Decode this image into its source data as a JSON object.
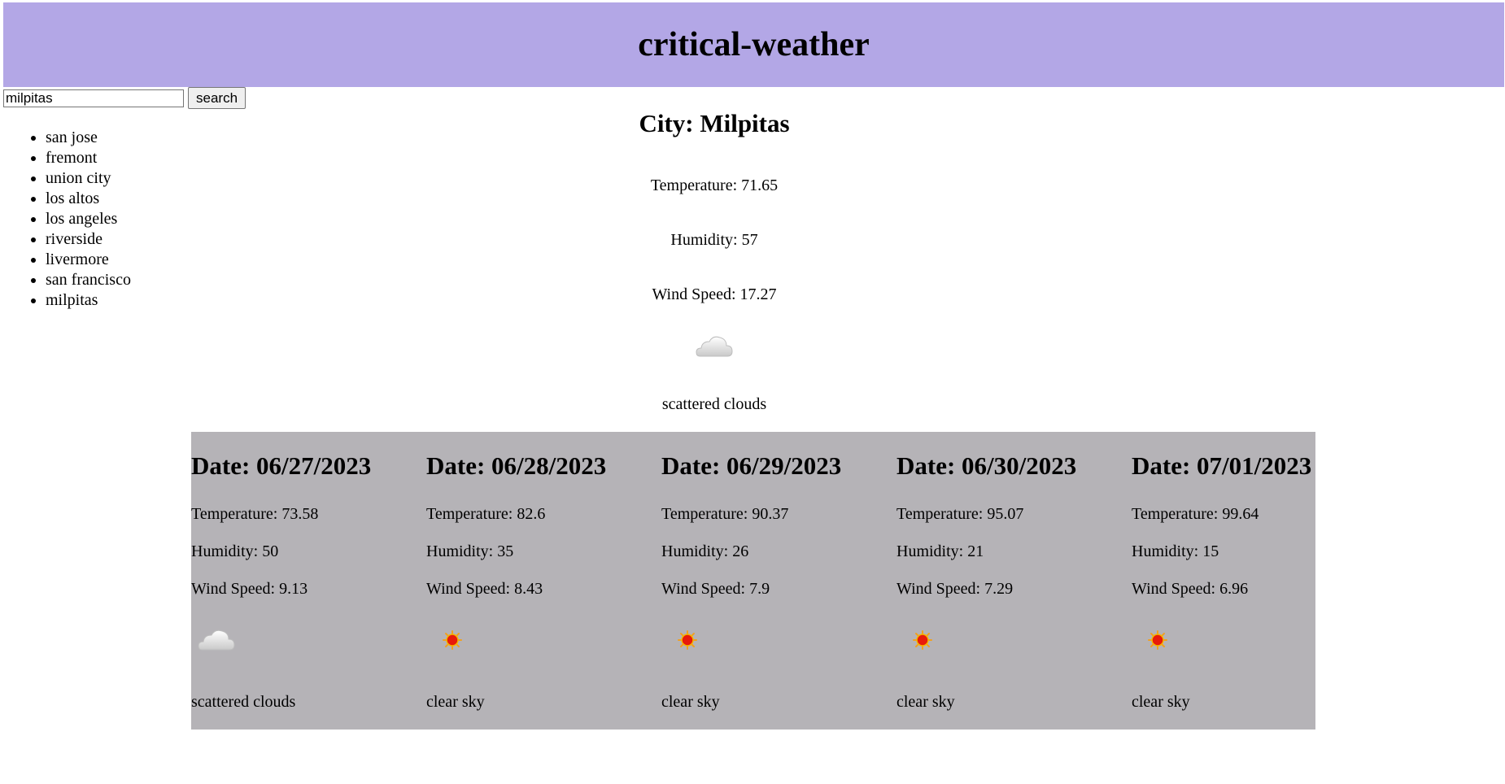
{
  "app": {
    "title": "critical-weather"
  },
  "search": {
    "value": "milpitas",
    "button_label": "search"
  },
  "history": [
    "san jose",
    "fremont",
    "union city",
    "los altos",
    "los angeles",
    "riverside",
    "livermore",
    "san francisco",
    "milpitas"
  ],
  "current": {
    "city_heading": "City: Milpitas",
    "temperature": "Temperature: 71.65",
    "humidity": "Humidity: 57",
    "wind": "Wind Speed: 17.27",
    "icon": "cloud-icon",
    "description": "scattered clouds"
  },
  "forecast": [
    {
      "date": "Date: 06/27/2023",
      "temperature": "Temperature: 73.58",
      "humidity": "Humidity: 50",
      "wind": "Wind Speed: 9.13",
      "icon": "cloud-icon",
      "description": "scattered clouds"
    },
    {
      "date": "Date: 06/28/2023",
      "temperature": "Temperature: 82.6",
      "humidity": "Humidity: 35",
      "wind": "Wind Speed: 8.43",
      "icon": "sun-icon",
      "description": "clear sky"
    },
    {
      "date": "Date: 06/29/2023",
      "temperature": "Temperature: 90.37",
      "humidity": "Humidity: 26",
      "wind": "Wind Speed: 7.9",
      "icon": "sun-icon",
      "description": "clear sky"
    },
    {
      "date": "Date: 06/30/2023",
      "temperature": "Temperature: 95.07",
      "humidity": "Humidity: 21",
      "wind": "Wind Speed: 7.29",
      "icon": "sun-icon",
      "description": "clear sky"
    },
    {
      "date": "Date: 07/01/2023",
      "temperature": "Temperature: 99.64",
      "humidity": "Humidity: 15",
      "wind": "Wind Speed: 6.96",
      "icon": "sun-icon",
      "description": "clear sky"
    }
  ],
  "colors": {
    "header_bg": "#b3a7e6",
    "forecast_bg": "#b5b3b7"
  }
}
